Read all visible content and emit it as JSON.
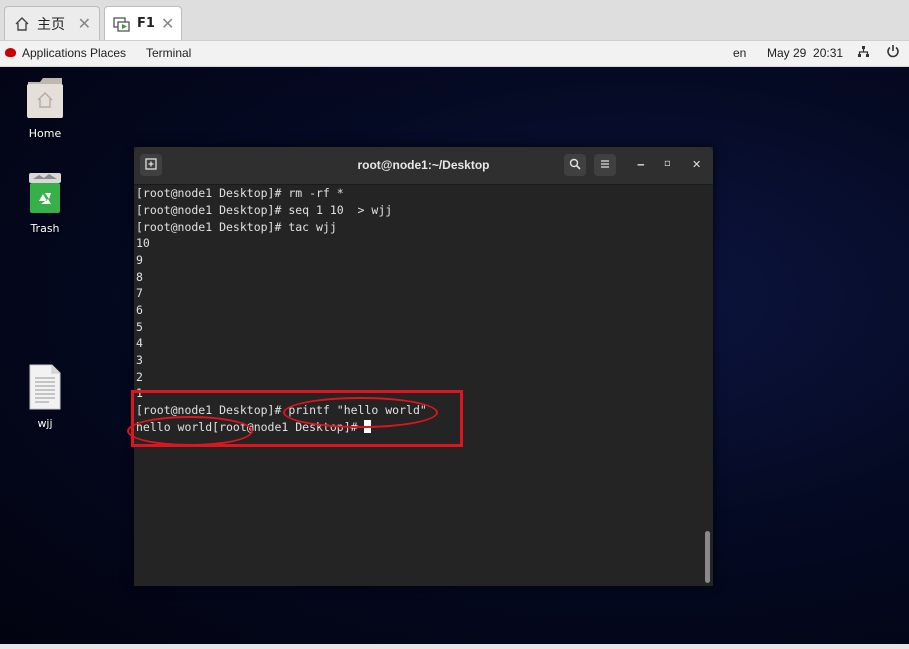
{
  "tabs": [
    {
      "label": "主页",
      "icon": "home-icon"
    },
    {
      "label": "F1",
      "icon": "vm-icon"
    }
  ],
  "topbar": {
    "applications": "Applications",
    "places": "Places",
    "terminal": "Terminal",
    "language": "en",
    "datetime": "May 29  20:31"
  },
  "desktop_icons": [
    {
      "label": "Home",
      "icon": "home-folder-icon"
    },
    {
      "label": "Trash",
      "icon": "trash-icon"
    },
    {
      "label": "wjj",
      "icon": "text-file-icon"
    }
  ],
  "terminal": {
    "title": "root@node1:~/Desktop",
    "lines": [
      "[root@node1 Desktop]# rm -rf *",
      "[root@node1 Desktop]# seq 1 10  > wjj",
      "[root@node1 Desktop]# tac wjj",
      "10",
      "9",
      "8",
      "7",
      "6",
      "5",
      "4",
      "3",
      "2",
      "1",
      "[root@node1 Desktop]# printf \"hello world\"",
      "hello world[root@node1 Desktop]# "
    ]
  },
  "colors": {
    "annotation": "#e0141e",
    "terminal_bg": "#242424",
    "desktop_bg": "#050a24"
  }
}
